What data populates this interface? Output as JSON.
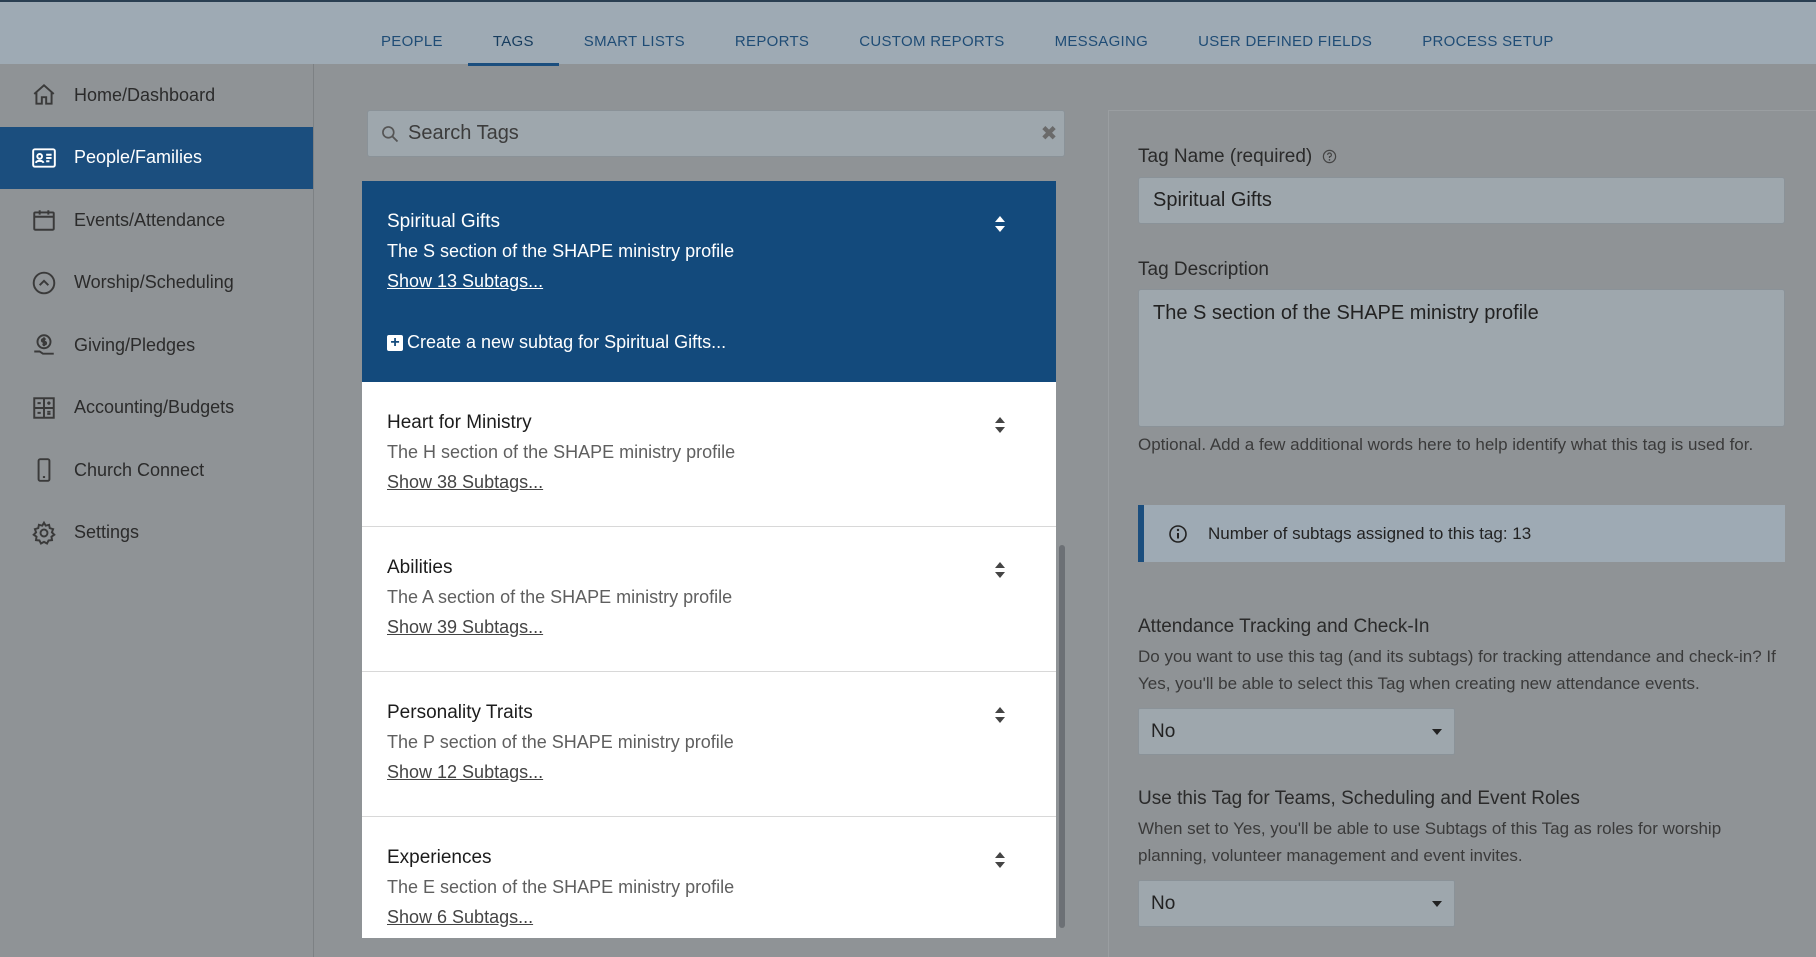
{
  "topnav": {
    "tabs": [
      {
        "label": "PEOPLE"
      },
      {
        "label": "TAGS",
        "active": true
      },
      {
        "label": "SMART LISTS"
      },
      {
        "label": "REPORTS"
      },
      {
        "label": "CUSTOM REPORTS"
      },
      {
        "label": "MESSAGING"
      },
      {
        "label": "USER DEFINED FIELDS"
      },
      {
        "label": "PROCESS SETUP"
      }
    ]
  },
  "sidebar": {
    "items": [
      {
        "label": "Home/Dashboard",
        "icon": "home-icon"
      },
      {
        "label": "People/Families",
        "icon": "id-card-icon",
        "active": true
      },
      {
        "label": "Events/Attendance",
        "icon": "calendar-icon"
      },
      {
        "label": "Worship/Scheduling",
        "icon": "chevron-circle-icon"
      },
      {
        "label": "Giving/Pledges",
        "icon": "money-hand-icon"
      },
      {
        "label": "Accounting/Budgets",
        "icon": "grid-icon"
      },
      {
        "label": "Church Connect",
        "icon": "mobile-icon"
      },
      {
        "label": "Settings",
        "icon": "gear-icon"
      }
    ]
  },
  "search": {
    "placeholder": "Search Tags",
    "value": ""
  },
  "tags": [
    {
      "name": "Spiritual Gifts",
      "description": "The S section of the SHAPE ministry profile",
      "link": "Show 13 Subtags...",
      "create": "Create a new subtag for Spiritual Gifts..."
    },
    {
      "name": "Heart for Ministry",
      "description": "The H section of the SHAPE ministry profile",
      "link": "Show 38 Subtags..."
    },
    {
      "name": "Abilities",
      "description": "The A section of the SHAPE ministry profile",
      "link": "Show 39 Subtags..."
    },
    {
      "name": "Personality Traits",
      "description": "The P section of the SHAPE ministry profile",
      "link": "Show 12 Subtags..."
    },
    {
      "name": "Experiences",
      "description": "The E section of the SHAPE ministry profile",
      "link": "Show 6 Subtags..."
    }
  ],
  "panel": {
    "tag_name_label": "Tag Name (required)",
    "tag_name_value": "Spiritual Gifts",
    "tag_description_label": "Tag Description",
    "tag_description_value": "The S section of the SHAPE ministry profile",
    "description_help": "Optional. Add a few additional words here to help identify what this tag is used for.",
    "info_text": "Number of subtags assigned to this tag: 13",
    "attendance_label": "Attendance Tracking and Check-In",
    "attendance_help": "Do you want to use this tag (and its subtags) for tracking attendance and check-in? If Yes, you'll be able to select this Tag when creating new attendance events.",
    "attendance_value": "No",
    "teams_label": "Use this Tag for Teams, Scheduling and Event Roles",
    "teams_help": "When set to Yes, you'll be able to use Subtags of this Tag as roles for worship planning, volunteer management and event invites.",
    "teams_value": "No"
  },
  "colors": {
    "accent": "#1b4e7e",
    "active_tag": "#134a7c"
  }
}
